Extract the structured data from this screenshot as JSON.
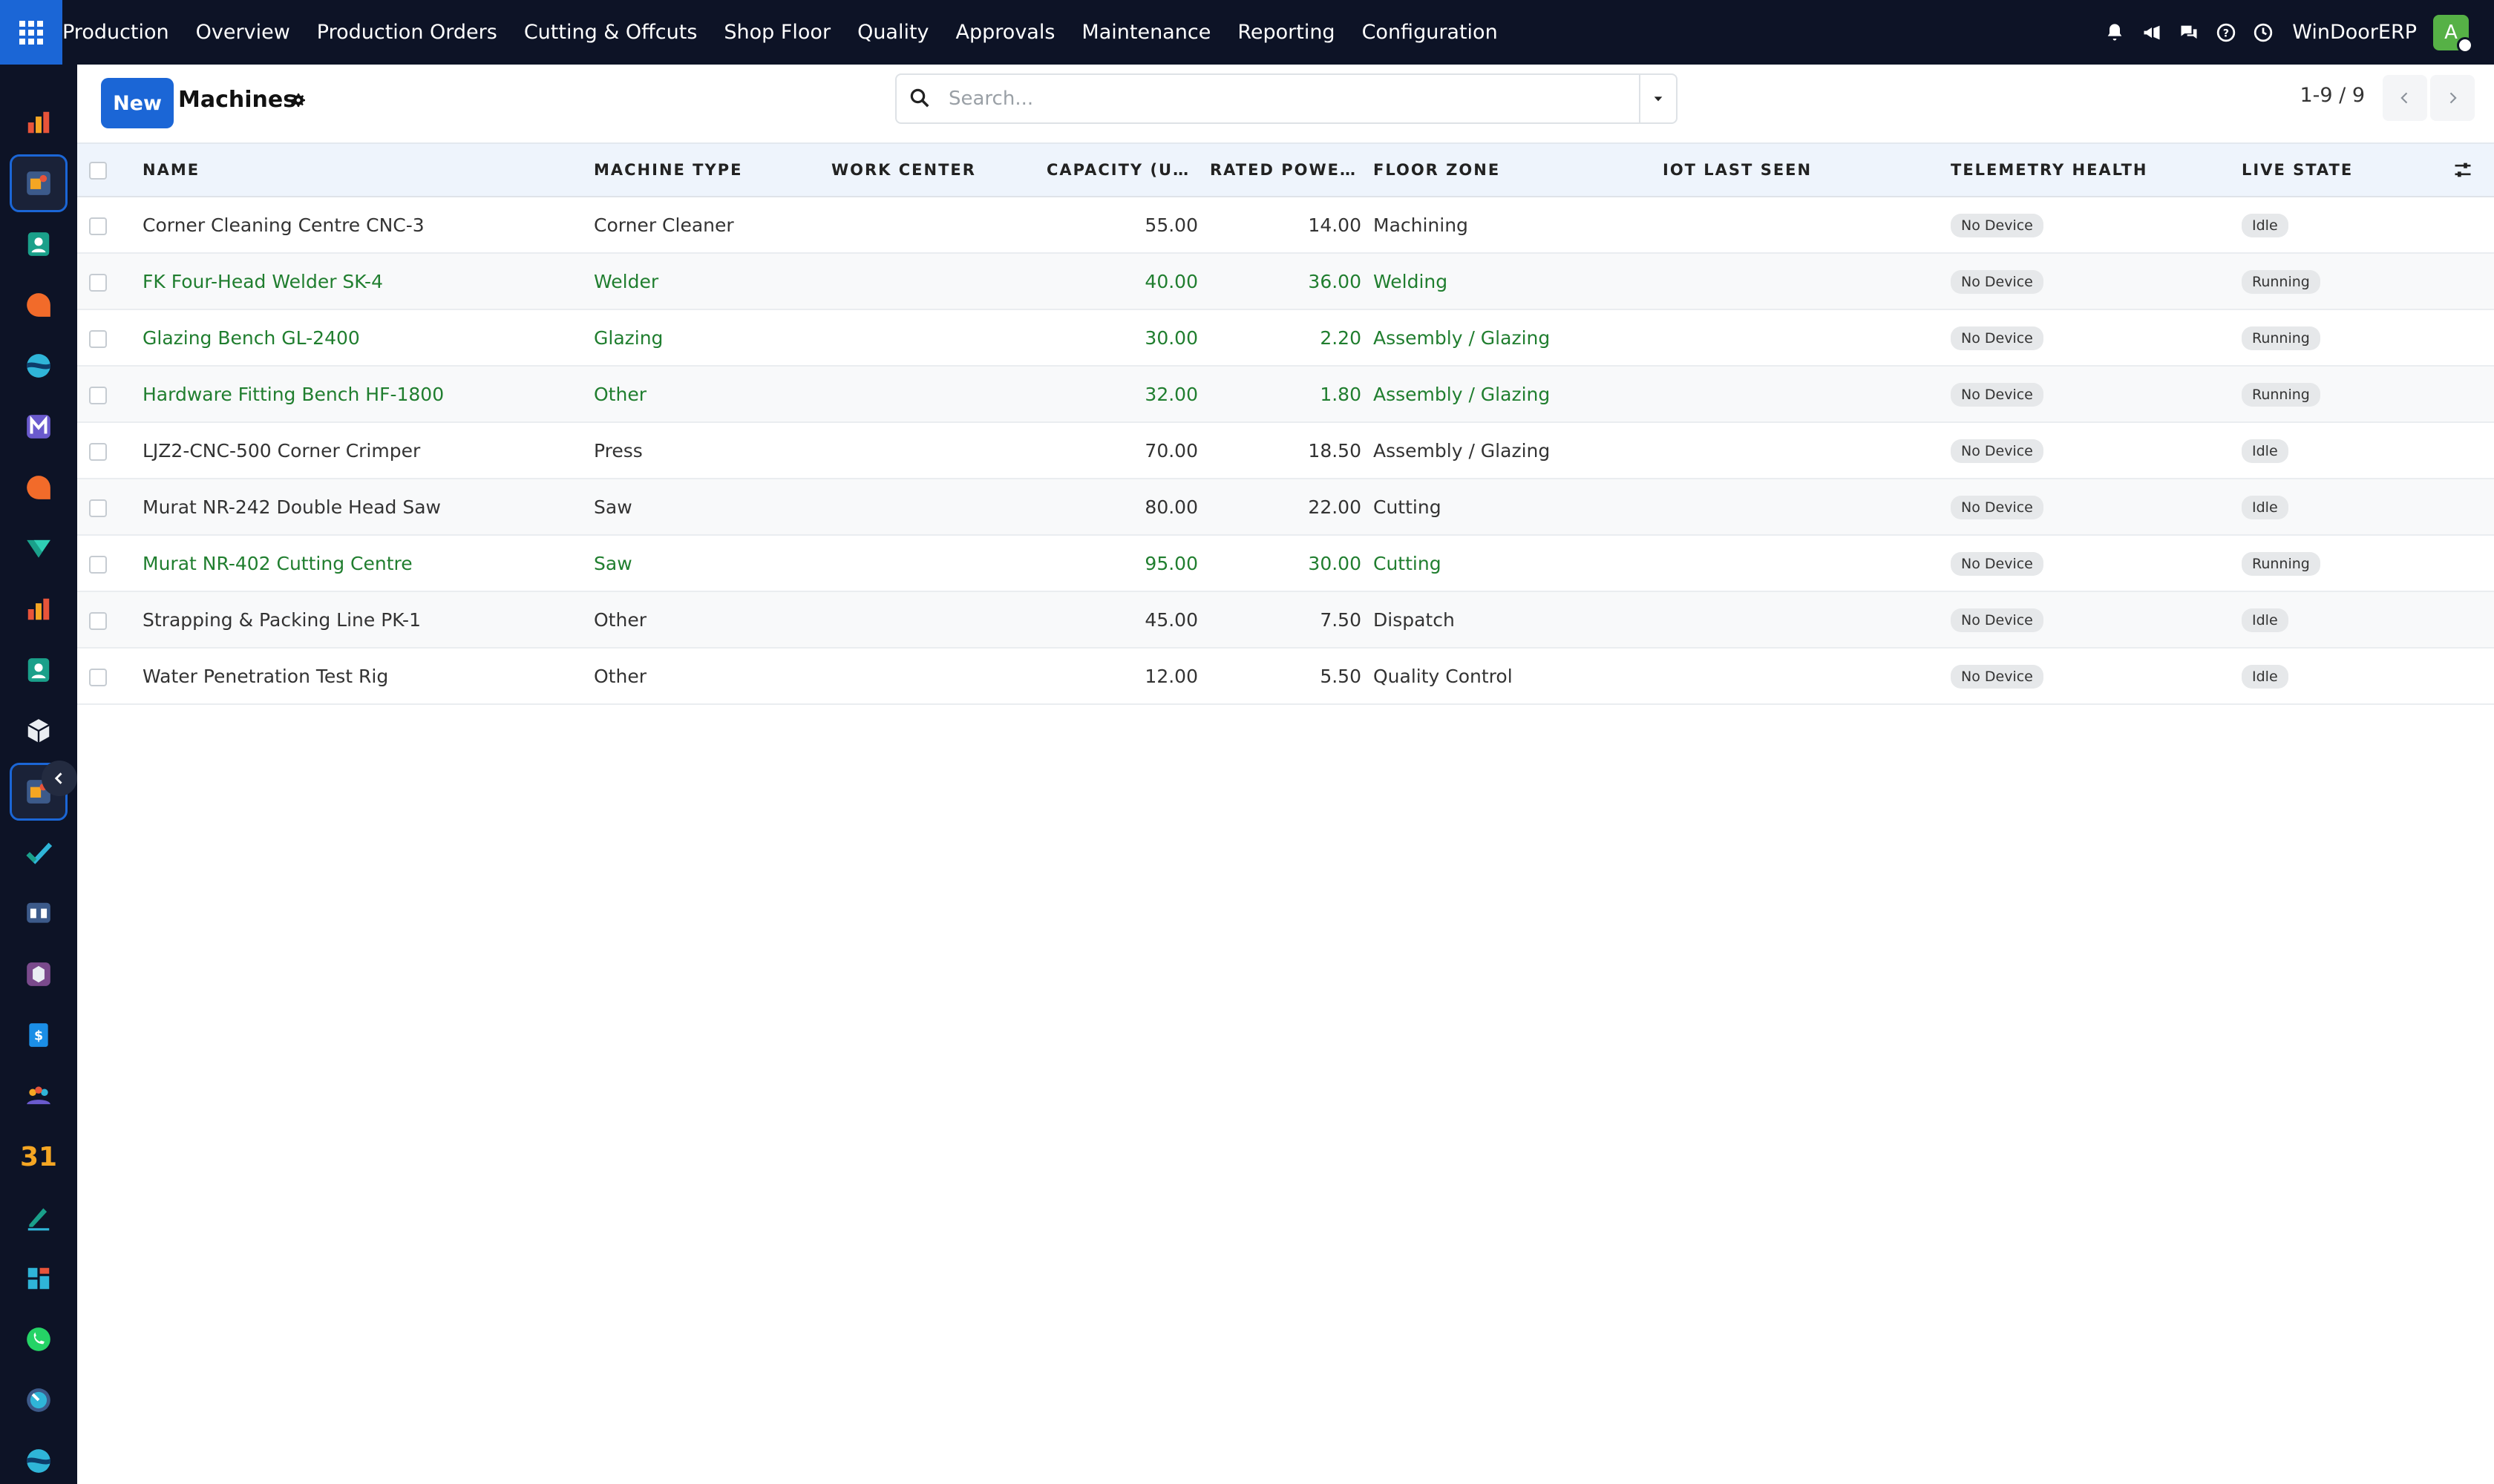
{
  "app": {
    "brand": "Production",
    "menu": [
      "Overview",
      "Production Orders",
      "Cutting & Offcuts",
      "Shop Floor",
      "Quality",
      "Approvals",
      "Maintenance",
      "Reporting",
      "Configuration"
    ],
    "company": "WinDoorERP",
    "avatar_letter": "A"
  },
  "control": {
    "new_label": "New",
    "title": "Machines",
    "search_placeholder": "Search...",
    "pager": "1-9 / 9"
  },
  "table": {
    "columns": [
      "Name",
      "Machine Type",
      "Work Center",
      "Capacity (Un...",
      "Rated Power...",
      "Floor Zone",
      "IoT Last Seen",
      "Telemetry Health",
      "Live State"
    ],
    "rows": [
      {
        "name": "Corner Cleaning Centre CNC-3",
        "type": "Corner Cleaner",
        "work_center": "",
        "capacity": "55.00",
        "power": "14.00",
        "zone": "Machining",
        "iot": "",
        "health": "No Device",
        "state": "Idle",
        "highlight": false
      },
      {
        "name": "FK Four-Head Welder SK-4",
        "type": "Welder",
        "work_center": "",
        "capacity": "40.00",
        "power": "36.00",
        "zone": "Welding",
        "iot": "",
        "health": "No Device",
        "state": "Running",
        "highlight": true
      },
      {
        "name": "Glazing Bench GL-2400",
        "type": "Glazing",
        "work_center": "",
        "capacity": "30.00",
        "power": "2.20",
        "zone": "Assembly / Glazing",
        "iot": "",
        "health": "No Device",
        "state": "Running",
        "highlight": true
      },
      {
        "name": "Hardware Fitting Bench HF-1800",
        "type": "Other",
        "work_center": "",
        "capacity": "32.00",
        "power": "1.80",
        "zone": "Assembly / Glazing",
        "iot": "",
        "health": "No Device",
        "state": "Running",
        "highlight": true
      },
      {
        "name": "LJZ2-CNC-500 Corner Crimper",
        "type": "Press",
        "work_center": "",
        "capacity": "70.00",
        "power": "18.50",
        "zone": "Assembly / Glazing",
        "iot": "",
        "health": "No Device",
        "state": "Idle",
        "highlight": false
      },
      {
        "name": "Murat NR-242 Double Head Saw",
        "type": "Saw",
        "work_center": "",
        "capacity": "80.00",
        "power": "22.00",
        "zone": "Cutting",
        "iot": "",
        "health": "No Device",
        "state": "Idle",
        "highlight": false
      },
      {
        "name": "Murat NR-402 Cutting Centre",
        "type": "Saw",
        "work_center": "",
        "capacity": "95.00",
        "power": "30.00",
        "zone": "Cutting",
        "iot": "",
        "health": "No Device",
        "state": "Running",
        "highlight": true
      },
      {
        "name": "Strapping & Packing Line PK-1",
        "type": "Other",
        "work_center": "",
        "capacity": "45.00",
        "power": "7.50",
        "zone": "Dispatch",
        "iot": "",
        "health": "No Device",
        "state": "Idle",
        "highlight": false
      },
      {
        "name": "Water Penetration Test Rig",
        "type": "Other",
        "work_center": "",
        "capacity": "12.00",
        "power": "5.50",
        "zone": "Quality Control",
        "iot": "",
        "health": "No Device",
        "state": "Idle",
        "highlight": false
      }
    ]
  },
  "sidebar": {
    "icons": [
      "reporting-app-icon",
      "production-app-icon",
      "contacts-app-icon",
      "discuss-app-icon",
      "website-app-icon",
      "email-marketing-app-icon",
      "livechat-app-icon",
      "project-app-icon",
      "dashboards-app-icon",
      "employees-app-icon",
      "inventory-app-icon",
      "manufacturing-app-icon",
      "todo-app-icon",
      "knowledge-app-icon",
      "purchase-app-icon",
      "invoicing-app-icon",
      "team-app-icon",
      "calendar-app-icon",
      "sign-app-icon",
      "apps-app-icon",
      "whatsapp-app-icon",
      "planning-app-icon",
      "field-service-app-icon"
    ],
    "calendar_day": "31"
  },
  "colors": {
    "navbar": "#0d1326",
    "accent": "#1b66d6",
    "highlight_text": "#207e2f",
    "avatar": "#56b146"
  }
}
